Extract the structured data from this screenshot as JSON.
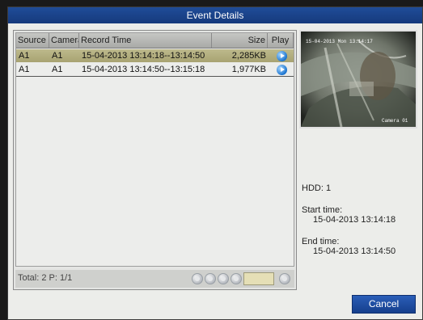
{
  "window": {
    "title": "Event Details"
  },
  "table": {
    "columns": [
      "Source",
      "Camera",
      "Record Time",
      "Size",
      "Play"
    ],
    "rows": [
      {
        "source": "A1",
        "camera": "A1",
        "record_time": "15-04-2013 13:14:18--13:14:50",
        "size": "2,285KB",
        "selected": true
      },
      {
        "source": "A1",
        "camera": "A1",
        "record_time": "15-04-2013 13:14:50--13:15:18",
        "size": "1,977KB",
        "selected": false
      }
    ]
  },
  "footer": {
    "total_text": "Total: 2  P: 1/1",
    "page_input_value": ""
  },
  "preview": {
    "timestamp": "15-04-2013 Mon 13:14:17",
    "camera_label": "Camera 01"
  },
  "info": {
    "hdd": "HDD: 1",
    "start_label": "Start time:",
    "start_value": "15-04-2013 13:14:18",
    "end_label": "End time:",
    "end_value": "15-04-2013 13:14:50"
  },
  "buttons": {
    "cancel": "Cancel"
  },
  "colors": {
    "title_bar": "#1f4c98",
    "selected_row": "#b4af80",
    "play_button": "#1a74d0",
    "page_input": "#e5dfb6"
  }
}
